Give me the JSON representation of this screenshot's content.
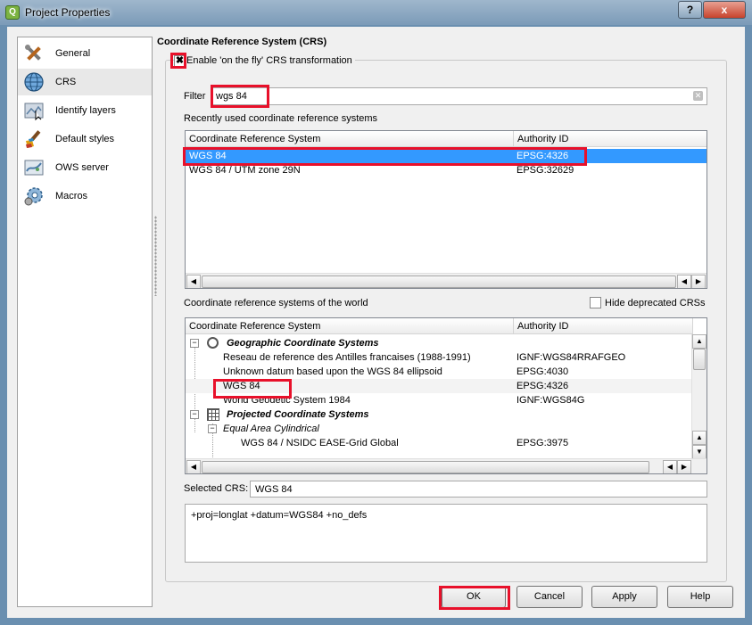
{
  "window": {
    "title": "Project Properties",
    "help_button": "?",
    "close_button": "x"
  },
  "sidebar": {
    "items": [
      {
        "label": "General",
        "icon": "tools-icon",
        "selected": false
      },
      {
        "label": "CRS",
        "icon": "globe-icon",
        "selected": true
      },
      {
        "label": "Identify layers",
        "icon": "identify-icon",
        "selected": false
      },
      {
        "label": "Default styles",
        "icon": "paintbrush-icon",
        "selected": false
      },
      {
        "label": "OWS server",
        "icon": "map-icon",
        "selected": false
      },
      {
        "label": "Macros",
        "icon": "gear-icon",
        "selected": false
      }
    ]
  },
  "crs": {
    "section_title": "Coordinate Reference System (CRS)",
    "enable_otf": {
      "label": "Enable 'on the fly' CRS transformation",
      "checked": true,
      "mark": "✖"
    },
    "filter": {
      "label": "Filter",
      "value": "wgs 84"
    },
    "recent": {
      "label": "Recently used coordinate reference systems",
      "headers": {
        "name": "Coordinate Reference System",
        "authority": "Authority ID"
      },
      "rows": [
        {
          "name": "WGS 84",
          "authority": "EPSG:4326",
          "selected": true
        },
        {
          "name": "WGS 84 / UTM zone 29N",
          "authority": "EPSG:32629",
          "selected": false
        }
      ]
    },
    "world": {
      "label": "Coordinate reference systems of the world",
      "hide_deprecated": "Hide deprecated CRSs",
      "headers": {
        "name": "Coordinate Reference System",
        "authority": "Authority ID"
      },
      "geo_group": "Geographic Coordinate Systems",
      "geo_rows": [
        {
          "name": "Reseau de reference des Antilles francaises (1988-1991)",
          "authority": "IGNF:WGS84RRAFGEO"
        },
        {
          "name": "Unknown datum based upon the WGS 84 ellipsoid",
          "authority": "EPSG:4030"
        },
        {
          "name": "WGS 84",
          "authority": "EPSG:4326"
        },
        {
          "name": "World Geodetic System 1984",
          "authority": "IGNF:WGS84G"
        }
      ],
      "proj_group": "Projected Coordinate Systems",
      "subgroup": "Equal Area Cylindrical",
      "proj_rows": [
        {
          "name": "WGS 84 / NSIDC EASE-Grid Global",
          "authority": "EPSG:3975"
        }
      ]
    },
    "selected": {
      "label": "Selected CRS:",
      "value": "WGS 84"
    },
    "proj_string": "+proj=longlat +datum=WGS84 +no_defs"
  },
  "buttons": {
    "ok": "OK",
    "cancel": "Cancel",
    "apply": "Apply",
    "help": "Help"
  },
  "colors": {
    "highlight": "#e8102a",
    "selection": "#3399ff"
  }
}
